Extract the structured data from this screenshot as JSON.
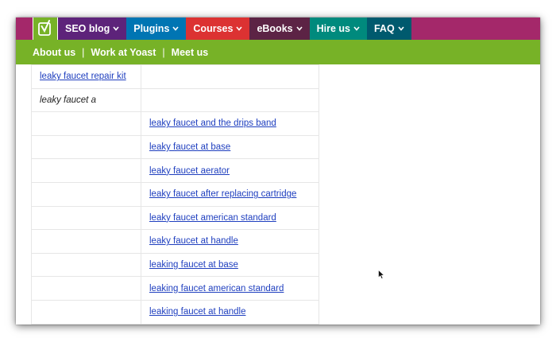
{
  "colors": {
    "nav_bg": "#a4286a",
    "logo_bg": "#77b227",
    "seo_blog_bg": "#5d237a",
    "plugins_bg": "#0075b3",
    "courses_bg": "#dc3232",
    "ebooks_bg": "#5c2345",
    "hire_us_bg": "#008a7d",
    "faq_bg": "#005a6e",
    "subnav_bg": "#77b227",
    "link": "#1f3fbf"
  },
  "nav": {
    "logo_icon": "yoast-logo-icon",
    "items": [
      {
        "label": "SEO blog",
        "icon": "chevron-down-icon"
      },
      {
        "label": "Plugins",
        "icon": "chevron-down-icon"
      },
      {
        "label": "Courses",
        "icon": "chevron-down-icon"
      },
      {
        "label": "eBooks",
        "icon": "chevron-down-icon"
      },
      {
        "label": "Hire us",
        "icon": "chevron-down-icon"
      },
      {
        "label": "FAQ",
        "icon": "chevron-down-icon"
      }
    ]
  },
  "subnav": {
    "links": [
      "About us",
      "Work at Yoast",
      "Meet us"
    ],
    "separator": "|"
  },
  "table": {
    "rows": [
      {
        "col1": "leaky faucet repair kit",
        "col1_link": true,
        "col2": ""
      },
      {
        "col1": "leaky faucet a",
        "col1_link": false,
        "col2": ""
      },
      {
        "col1": "",
        "col2": "leaky faucet and the drips band"
      },
      {
        "col1": "",
        "col2": "leaky faucet at base"
      },
      {
        "col1": "",
        "col2": "leaky faucet aerator"
      },
      {
        "col1": "",
        "col2": "leaky faucet after replacing cartridge"
      },
      {
        "col1": "",
        "col2": "leaky faucet american standard"
      },
      {
        "col1": "",
        "col2": "leaky faucet at handle"
      },
      {
        "col1": "",
        "col2": "leaking faucet at base"
      },
      {
        "col1": "",
        "col2": "leaking faucet american standard"
      },
      {
        "col1": "",
        "col2": "leaking faucet at handle"
      }
    ]
  }
}
